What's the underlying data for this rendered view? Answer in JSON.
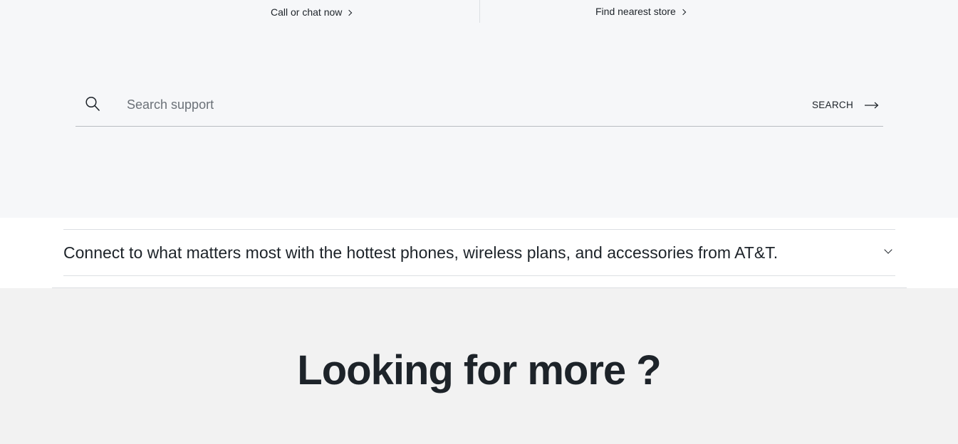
{
  "contact": {
    "call_label": "Call or chat now",
    "store_label": "Find nearest store"
  },
  "search": {
    "placeholder": "Search support",
    "button_label": "SEARCH"
  },
  "accordion": {
    "title": "Connect to what matters most with the hottest phones, wireless plans, and accessories from AT&T."
  },
  "more": {
    "title": "Looking for more ?"
  },
  "icons": {
    "search": "search-icon",
    "arrow": "arrow-right-icon",
    "chevron_right": "chevron-right-icon",
    "chevron_down": "chevron-down-icon"
  },
  "colors": {
    "text": "#1d2329",
    "top_bg": "#f6f7f9",
    "bottom_bg": "#f2f2f2"
  }
}
